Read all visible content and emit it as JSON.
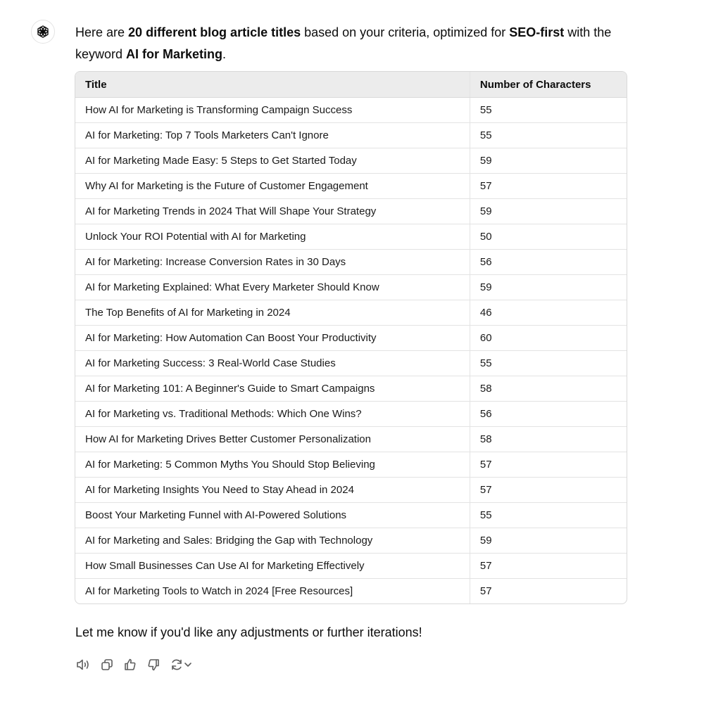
{
  "message": {
    "intro": {
      "p1": "Here are ",
      "b1": "20 different blog article titles",
      "p2": " based on your criteria, optimized for ",
      "b2": "SEO-first",
      "p3": " with the keyword ",
      "b3": "AI for Marketing",
      "p4": "."
    },
    "table": {
      "headers": [
        "Title",
        "Number of Characters"
      ],
      "rows": [
        [
          "How AI for Marketing is Transforming Campaign Success",
          "55"
        ],
        [
          "AI for Marketing: Top 7 Tools Marketers Can't Ignore",
          "55"
        ],
        [
          "AI for Marketing Made Easy: 5 Steps to Get Started Today",
          "59"
        ],
        [
          "Why AI for Marketing is the Future of Customer Engagement",
          "57"
        ],
        [
          "AI for Marketing Trends in 2024 That Will Shape Your Strategy",
          "59"
        ],
        [
          "Unlock Your ROI Potential with AI for Marketing",
          "50"
        ],
        [
          "AI for Marketing: Increase Conversion Rates in 30 Days",
          "56"
        ],
        [
          "AI for Marketing Explained: What Every Marketer Should Know",
          "59"
        ],
        [
          "The Top Benefits of AI for Marketing in 2024",
          "46"
        ],
        [
          "AI for Marketing: How Automation Can Boost Your Productivity",
          "60"
        ],
        [
          "AI for Marketing Success: 3 Real-World Case Studies",
          "55"
        ],
        [
          "AI for Marketing 101: A Beginner's Guide to Smart Campaigns",
          "58"
        ],
        [
          "AI for Marketing vs. Traditional Methods: Which One Wins?",
          "56"
        ],
        [
          "How AI for Marketing Drives Better Customer Personalization",
          "58"
        ],
        [
          "AI for Marketing: 5 Common Myths You Should Stop Believing",
          "57"
        ],
        [
          "AI for Marketing Insights You Need to Stay Ahead in 2024",
          "57"
        ],
        [
          "Boost Your Marketing Funnel with AI-Powered Solutions",
          "55"
        ],
        [
          "AI for Marketing and Sales: Bridging the Gap with Technology",
          "59"
        ],
        [
          "How Small Businesses Can Use AI for Marketing Effectively",
          "57"
        ],
        [
          "AI for Marketing Tools to Watch in 2024 [Free Resources]",
          "57"
        ]
      ]
    },
    "outro": "Let me know if you'd like any adjustments or further iterations!"
  },
  "actions": {
    "icons": [
      "read-aloud-icon",
      "copy-icon",
      "thumbs-up-icon",
      "thumbs-down-icon",
      "regenerate-icon",
      "chevron-down-icon"
    ]
  },
  "colors": {
    "text": "#0d0d0d",
    "header_bg": "#ececec",
    "border": "#d9d9d9",
    "icon": "#5d5d5d"
  }
}
